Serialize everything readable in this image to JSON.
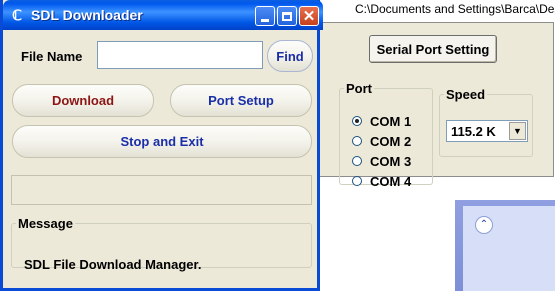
{
  "background": {
    "path_text": "C:\\Documents and Settings\\Barca\\Deskt",
    "collapse_icon": "chevron-double-up-icon"
  },
  "port_window": {
    "serial_button_label": "Serial Port Setting",
    "port_group_label": "Port",
    "ports": [
      {
        "label": "COM 1",
        "checked": true
      },
      {
        "label": "COM 2",
        "checked": false
      },
      {
        "label": "COM 3",
        "checked": false
      },
      {
        "label": "COM 4",
        "checked": false
      }
    ],
    "speed_group_label": "Speed",
    "speed_value": "115.2 K"
  },
  "main_window": {
    "title": "SDL Downloader",
    "file_name_label": "File Name",
    "file_name_value": "",
    "find_label": "Find",
    "download_label": "Download",
    "port_setup_label": "Port Setup",
    "stop_exit_label": "Stop and Exit",
    "status_text": "",
    "message_group_label": "Message",
    "message_text": "SDL File Download Manager."
  },
  "colors": {
    "title_bar": "#0058ee",
    "window_face": "#ece9d8",
    "download_text": "#8c1616",
    "button_text_blue": "#1a2ea8",
    "close_button": "#c8401c"
  }
}
